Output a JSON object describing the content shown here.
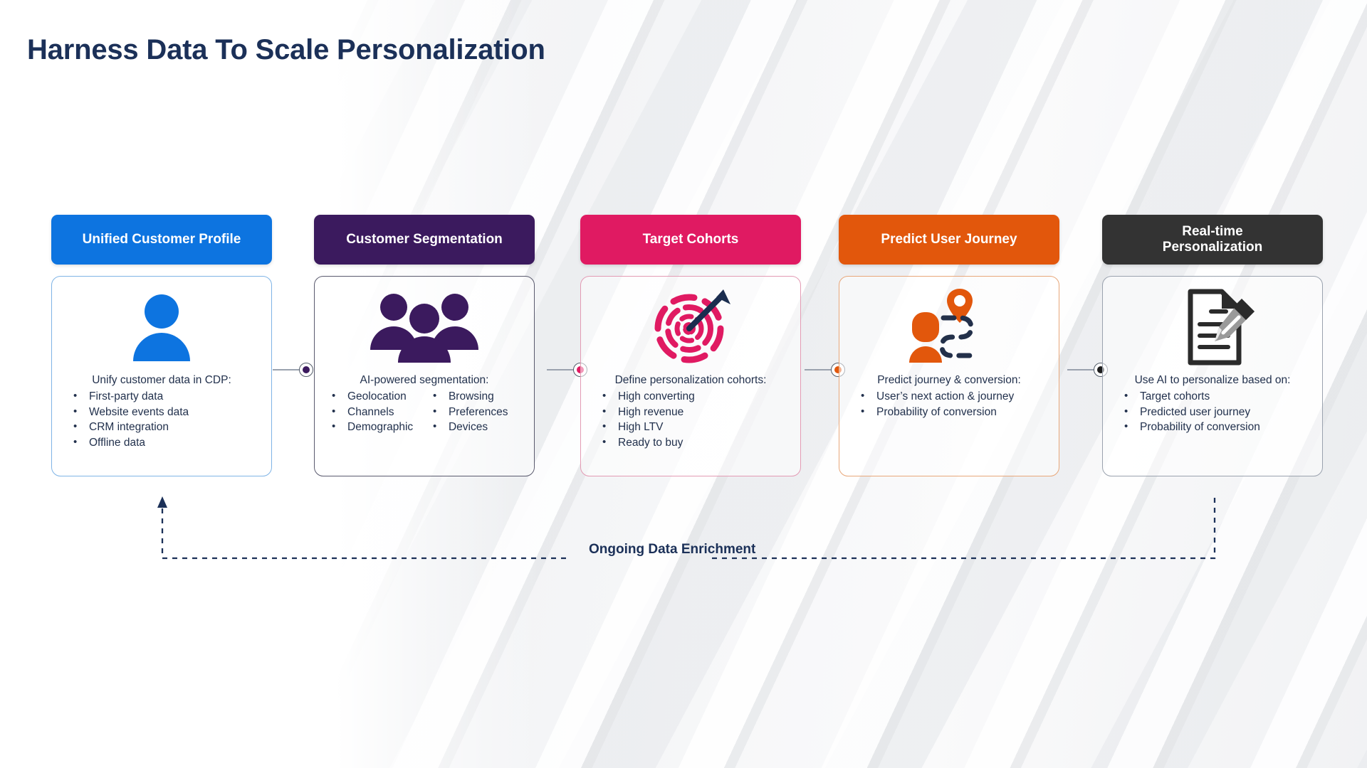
{
  "title": "Harness Data To Scale Personalization",
  "colors": {
    "title": "#1b3058",
    "blue": "#0d74e0",
    "purple": "#3b1a5e",
    "pink": "#e01a62",
    "orange": "#e2570c",
    "charcoal": "#333333",
    "body_text": "#22314d"
  },
  "feedback_loop": {
    "label": "Ongoing Data Enrichment"
  },
  "connectors": [
    {
      "name": "connector-1-2",
      "dot_color": "#3b1a5e"
    },
    {
      "name": "connector-2-3",
      "dot_color": "#e01a62"
    },
    {
      "name": "connector-3-4",
      "dot_color": "#e2570c"
    },
    {
      "name": "connector-4-5",
      "dot_color": "#1c1c1c"
    }
  ],
  "stages": [
    {
      "header": "Unified Customer Profile",
      "accent": "#0d74e0",
      "border": "#7fb4e6",
      "icon": "single-person-icon",
      "lead": "Unify customer data in CDP:",
      "bullets": [
        "First-party data",
        "Website events data",
        "CRM integration",
        "Offline data"
      ],
      "bullets_b": []
    },
    {
      "header": "Customer Segmentation",
      "accent": "#3b1a5e",
      "border": "#5a5a6e",
      "icon": "group-of-people-icon",
      "lead": "AI-powered segmentation:",
      "bullets": [
        "Geolocation",
        "Channels",
        "Demographic"
      ],
      "bullets_b": [
        "Browsing",
        "Preferences",
        "Devices"
      ]
    },
    {
      "header": "Target Cohorts",
      "accent": "#e01a62",
      "border": "#e39bb4",
      "icon": "target-arrow-icon",
      "lead": "Define personalization cohorts:",
      "bullets": [
        "High converting",
        "High revenue",
        "High LTV",
        "Ready to buy"
      ],
      "bullets_b": []
    },
    {
      "header": "Predict User Journey",
      "accent": "#e2570c",
      "border": "#e8a77a",
      "icon": "user-journey-pin-icon",
      "lead": "Predict journey & conversion:",
      "bullets": [
        "User’s next action & journey",
        "Probability of conversion"
      ],
      "bullets_b": []
    },
    {
      "header": "Real-time\nPersonalization",
      "header_line1": "Real-time",
      "header_line2": "Personalization",
      "accent": "#333333",
      "border": "#9aa2ae",
      "icon": "document-pencil-icon",
      "lead": "Use AI to personalize based on:",
      "bullets": [
        "Target cohorts",
        "Predicted user journey",
        "Probability of conversion"
      ],
      "bullets_b": []
    }
  ]
}
